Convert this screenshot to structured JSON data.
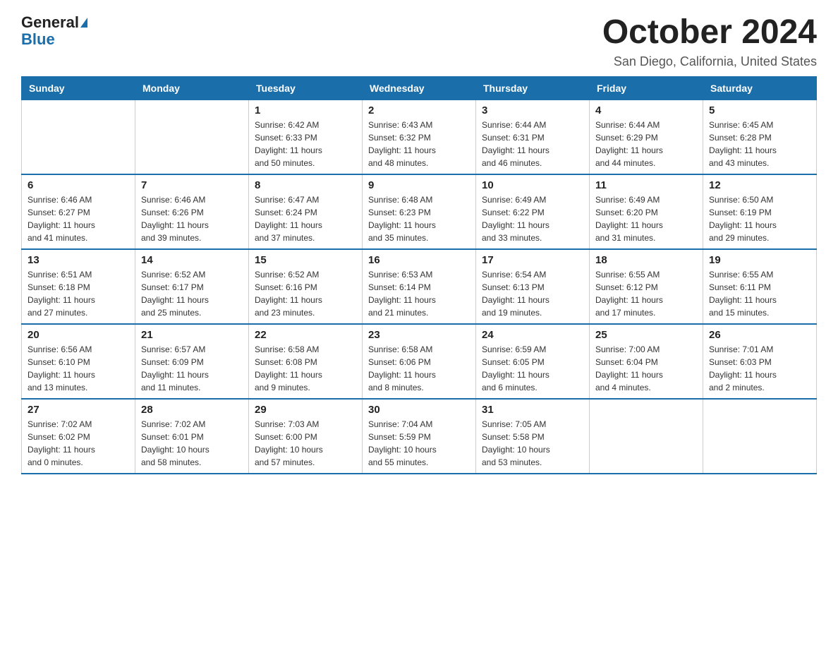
{
  "header": {
    "logo_general": "General",
    "logo_blue": "Blue",
    "title": "October 2024",
    "subtitle": "San Diego, California, United States"
  },
  "calendar": {
    "weekdays": [
      "Sunday",
      "Monday",
      "Tuesday",
      "Wednesday",
      "Thursday",
      "Friday",
      "Saturday"
    ],
    "weeks": [
      [
        {
          "day": "",
          "info": ""
        },
        {
          "day": "",
          "info": ""
        },
        {
          "day": "1",
          "info": "Sunrise: 6:42 AM\nSunset: 6:33 PM\nDaylight: 11 hours\nand 50 minutes."
        },
        {
          "day": "2",
          "info": "Sunrise: 6:43 AM\nSunset: 6:32 PM\nDaylight: 11 hours\nand 48 minutes."
        },
        {
          "day": "3",
          "info": "Sunrise: 6:44 AM\nSunset: 6:31 PM\nDaylight: 11 hours\nand 46 minutes."
        },
        {
          "day": "4",
          "info": "Sunrise: 6:44 AM\nSunset: 6:29 PM\nDaylight: 11 hours\nand 44 minutes."
        },
        {
          "day": "5",
          "info": "Sunrise: 6:45 AM\nSunset: 6:28 PM\nDaylight: 11 hours\nand 43 minutes."
        }
      ],
      [
        {
          "day": "6",
          "info": "Sunrise: 6:46 AM\nSunset: 6:27 PM\nDaylight: 11 hours\nand 41 minutes."
        },
        {
          "day": "7",
          "info": "Sunrise: 6:46 AM\nSunset: 6:26 PM\nDaylight: 11 hours\nand 39 minutes."
        },
        {
          "day": "8",
          "info": "Sunrise: 6:47 AM\nSunset: 6:24 PM\nDaylight: 11 hours\nand 37 minutes."
        },
        {
          "day": "9",
          "info": "Sunrise: 6:48 AM\nSunset: 6:23 PM\nDaylight: 11 hours\nand 35 minutes."
        },
        {
          "day": "10",
          "info": "Sunrise: 6:49 AM\nSunset: 6:22 PM\nDaylight: 11 hours\nand 33 minutes."
        },
        {
          "day": "11",
          "info": "Sunrise: 6:49 AM\nSunset: 6:20 PM\nDaylight: 11 hours\nand 31 minutes."
        },
        {
          "day": "12",
          "info": "Sunrise: 6:50 AM\nSunset: 6:19 PM\nDaylight: 11 hours\nand 29 minutes."
        }
      ],
      [
        {
          "day": "13",
          "info": "Sunrise: 6:51 AM\nSunset: 6:18 PM\nDaylight: 11 hours\nand 27 minutes."
        },
        {
          "day": "14",
          "info": "Sunrise: 6:52 AM\nSunset: 6:17 PM\nDaylight: 11 hours\nand 25 minutes."
        },
        {
          "day": "15",
          "info": "Sunrise: 6:52 AM\nSunset: 6:16 PM\nDaylight: 11 hours\nand 23 minutes."
        },
        {
          "day": "16",
          "info": "Sunrise: 6:53 AM\nSunset: 6:14 PM\nDaylight: 11 hours\nand 21 minutes."
        },
        {
          "day": "17",
          "info": "Sunrise: 6:54 AM\nSunset: 6:13 PM\nDaylight: 11 hours\nand 19 minutes."
        },
        {
          "day": "18",
          "info": "Sunrise: 6:55 AM\nSunset: 6:12 PM\nDaylight: 11 hours\nand 17 minutes."
        },
        {
          "day": "19",
          "info": "Sunrise: 6:55 AM\nSunset: 6:11 PM\nDaylight: 11 hours\nand 15 minutes."
        }
      ],
      [
        {
          "day": "20",
          "info": "Sunrise: 6:56 AM\nSunset: 6:10 PM\nDaylight: 11 hours\nand 13 minutes."
        },
        {
          "day": "21",
          "info": "Sunrise: 6:57 AM\nSunset: 6:09 PM\nDaylight: 11 hours\nand 11 minutes."
        },
        {
          "day": "22",
          "info": "Sunrise: 6:58 AM\nSunset: 6:08 PM\nDaylight: 11 hours\nand 9 minutes."
        },
        {
          "day": "23",
          "info": "Sunrise: 6:58 AM\nSunset: 6:06 PM\nDaylight: 11 hours\nand 8 minutes."
        },
        {
          "day": "24",
          "info": "Sunrise: 6:59 AM\nSunset: 6:05 PM\nDaylight: 11 hours\nand 6 minutes."
        },
        {
          "day": "25",
          "info": "Sunrise: 7:00 AM\nSunset: 6:04 PM\nDaylight: 11 hours\nand 4 minutes."
        },
        {
          "day": "26",
          "info": "Sunrise: 7:01 AM\nSunset: 6:03 PM\nDaylight: 11 hours\nand 2 minutes."
        }
      ],
      [
        {
          "day": "27",
          "info": "Sunrise: 7:02 AM\nSunset: 6:02 PM\nDaylight: 11 hours\nand 0 minutes."
        },
        {
          "day": "28",
          "info": "Sunrise: 7:02 AM\nSunset: 6:01 PM\nDaylight: 10 hours\nand 58 minutes."
        },
        {
          "day": "29",
          "info": "Sunrise: 7:03 AM\nSunset: 6:00 PM\nDaylight: 10 hours\nand 57 minutes."
        },
        {
          "day": "30",
          "info": "Sunrise: 7:04 AM\nSunset: 5:59 PM\nDaylight: 10 hours\nand 55 minutes."
        },
        {
          "day": "31",
          "info": "Sunrise: 7:05 AM\nSunset: 5:58 PM\nDaylight: 10 hours\nand 53 minutes."
        },
        {
          "day": "",
          "info": ""
        },
        {
          "day": "",
          "info": ""
        }
      ]
    ]
  }
}
